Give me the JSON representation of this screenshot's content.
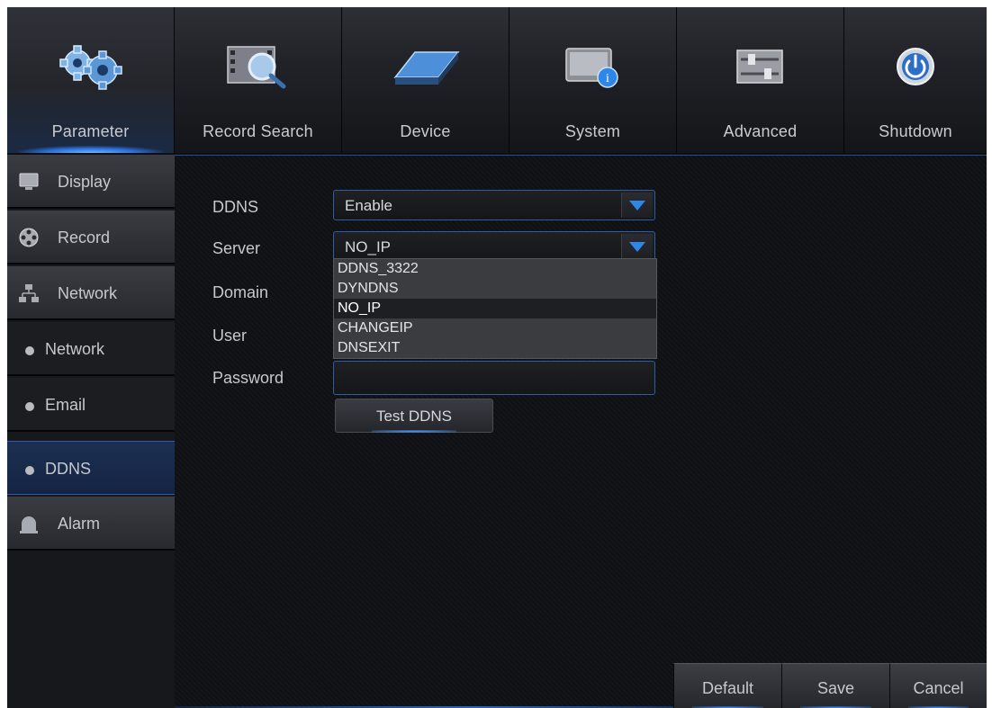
{
  "nav": {
    "tabs": [
      {
        "label": "Parameter",
        "icon": "gears-icon"
      },
      {
        "label": "Record Search",
        "icon": "film-search-icon"
      },
      {
        "label": "Device",
        "icon": "hard-drive-icon"
      },
      {
        "label": "System",
        "icon": "monitor-info-icon"
      },
      {
        "label": "Advanced",
        "icon": "sliders-icon"
      },
      {
        "label": "Shutdown",
        "icon": "power-icon"
      }
    ],
    "active": "Parameter"
  },
  "sidebar": {
    "items": [
      {
        "label": "Display",
        "icon": "monitor-icon"
      },
      {
        "label": "Record",
        "icon": "film-reel-icon"
      },
      {
        "label": "Network",
        "icon": "network-icon"
      },
      {
        "label": "Network"
      },
      {
        "label": "Email"
      },
      {
        "label": "DDNS"
      },
      {
        "label": "Alarm",
        "icon": "alarm-bell-icon"
      }
    ],
    "selected": "DDNS"
  },
  "form": {
    "ddns_label": "DDNS",
    "ddns_value": "Enable",
    "server_label": "Server",
    "server_value": "NO_IP",
    "domain_label": "Domain",
    "user_label": "User",
    "password_label": "Password",
    "server_options": [
      "DDNS_3322",
      "DYNDNS",
      "NO_IP",
      "CHANGEIP",
      "DNSEXIT"
    ],
    "test_button": "Test DDNS"
  },
  "footer": {
    "default_label": "Default",
    "save_label": "Save",
    "cancel_label": "Cancel"
  },
  "colors": {
    "accent": "#2d86e8",
    "selected_row": "#1e1f22",
    "background": "#0e0f12"
  }
}
